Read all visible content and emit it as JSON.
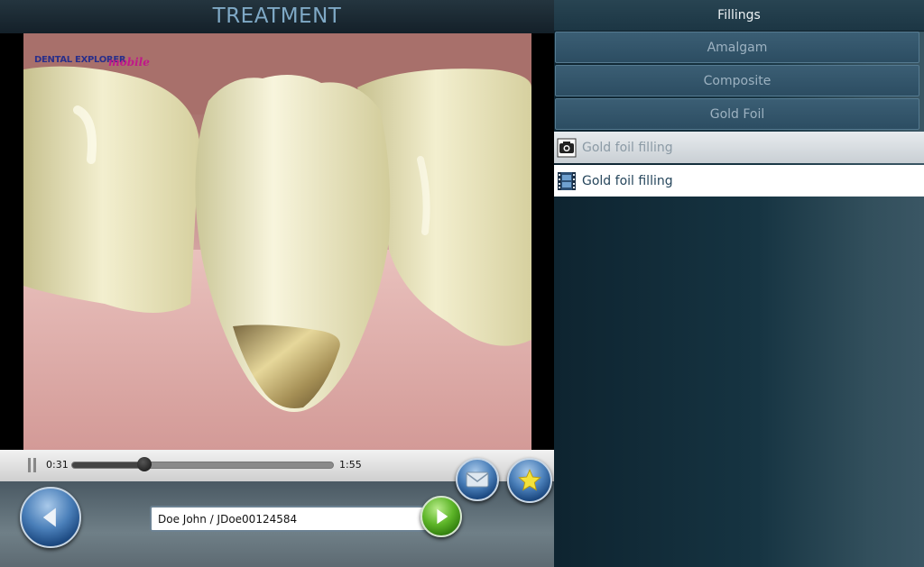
{
  "header": {
    "title": "TREATMENT"
  },
  "video": {
    "watermark_line1": "DENTAL EXPLORER",
    "watermark_line2": "mobile",
    "watermark_line3": "",
    "current_time": "0:31",
    "total_time": "1:55",
    "progress": 0.28
  },
  "actions": {
    "mail_icon": "envelope-icon",
    "favorite_icon": "star-icon",
    "back_icon": "arrow-left-icon",
    "go_icon": "arrow-right-icon"
  },
  "patient": {
    "value": "Doe John / JDoe00124584"
  },
  "sidebar": {
    "header": "Fillings",
    "categories": [
      {
        "label": "Amalgam"
      },
      {
        "label": "Composite"
      },
      {
        "label": "Gold Foil"
      }
    ],
    "items": [
      {
        "label": "Gold foil filling",
        "icon": "camera-icon"
      },
      {
        "label": "Gold foil filling",
        "icon": "film-icon"
      }
    ]
  },
  "colors": {
    "title_text": "#7fa9c6",
    "go_button": "#5db528",
    "action_button": "#4a7fb9"
  }
}
